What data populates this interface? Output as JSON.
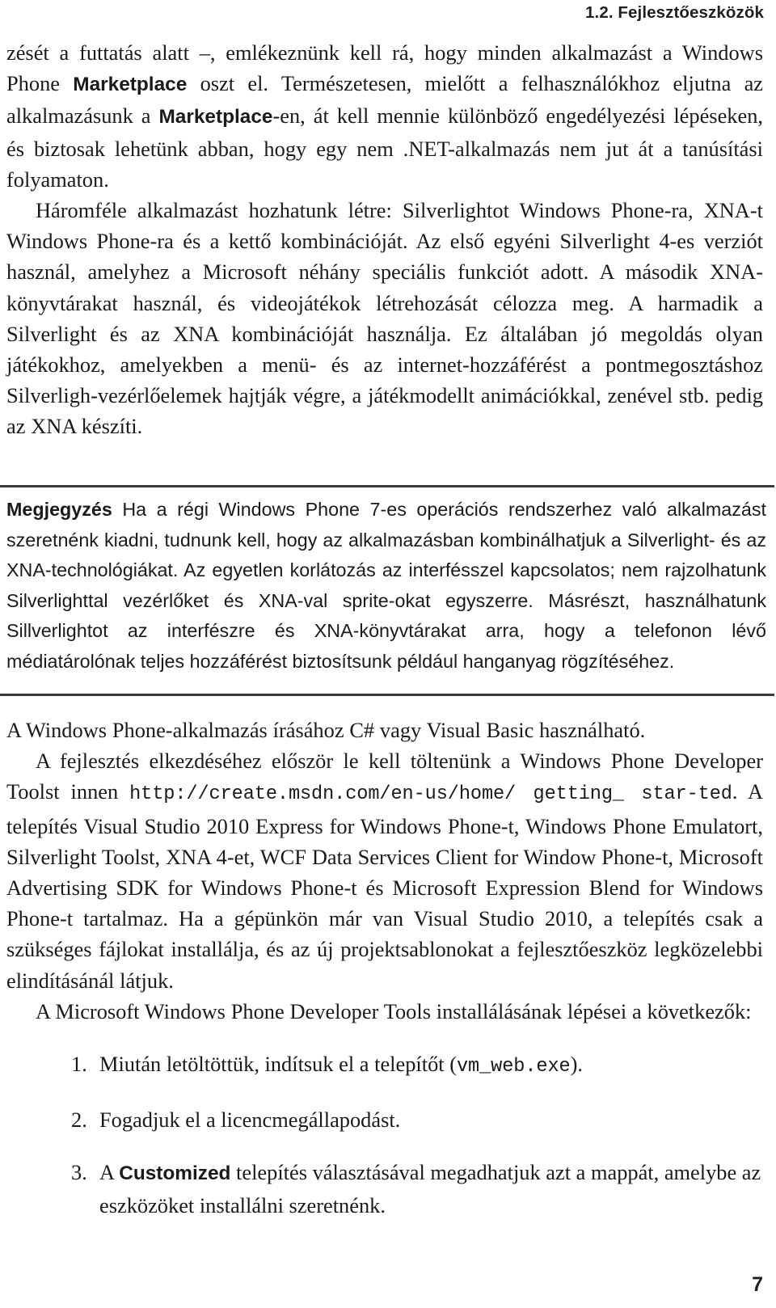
{
  "header": {
    "section_number_title": "1.2. Fejlesztőeszközök"
  },
  "body": {
    "para1_part1": "zését a futtatás alatt –, emlékeznünk kell rá, hogy minden alkalmazást a Windows Phone ",
    "para1_bold1": "Marketplace",
    "para1_part2": " oszt el. Természetesen, mielőtt a felhasználókhoz eljutna az alkalmazásunk a ",
    "para1_bold2": "Marketplace",
    "para1_part3": "-en, át kell mennie különböző engedélyezési lépéseken, és biztosak lehetünk abban, hogy egy nem .NET-alkalmazás nem jut át a tanúsítási folyamaton.",
    "para2": "Háromféle alkalmazást hozhatunk létre: Silverlightot Windows Phone-ra, XNA-t Windows Phone-ra és a kettő kombinációját. Az első egyéni Silverlight 4-es verziót használ, amelyhez a Microsoft néhány speciális funkciót adott. A második XNA-könyvtárakat használ, és videojátékok létrehozását célozza meg. A harmadik a Silverlight és az XNA kombinációját használja. Ez általában jó megoldás olyan játékokhoz, amelyekben a menü- és az internet-hozzáférést a pontmegosztáshoz Silverligh-vezérlőelemek hajtják végre, a játékmodellt animációkkal, zenével stb. pedig az XNA készíti."
  },
  "note": {
    "label": "Megjegyzés",
    "text": " Ha a régi Windows Phone 7-es operációs rendszerhez való alkalmazást szeretnénk kiadni, tudnunk kell, hogy az alkalmazásban kombinálhatjuk a Silverlight- és az XNA-technológiákat. Az egyetlen korlátozás az interfésszel kapcsolatos; nem rajzolhatunk Silverlighttal vezérlőket és XNA-val sprite-okat egyszerre. Másrészt, használhatunk Sillverlightot az interfészre és XNA-könyvtárakat arra, hogy a telefonon lévő médiatárolónak teljes hozzáférést biztosítsunk például hanganyag rögzítéséhez."
  },
  "lower": {
    "para3": "A Windows Phone-alkalmazás írásához C# vagy Visual Basic használható.",
    "para4_part1": "A fejlesztés elkezdéséhez először le kell töltenünk a Windows Phone Developer Toolst innen ",
    "para4_url": "http://create.msdn.com/en-us/home/ getting_ star-ted",
    "para4_part2": ". A telepítés Visual Studio 2010 Express for Windows Phone-t, Windows Phone Emulatort, Silverlight Toolst, XNA 4-et, WCF Data Services Client for Window Phone-t, Microsoft Advertising SDK for Windows Phone-t és Microsoft Expression Blend for Windows Phone-t tartalmaz. Ha a gépünkön már van Visual Studio 2010, a telepítés csak a szükséges fájlokat installálja, és az új projektsablonokat a fejlesztőeszköz legközelebbi elindításánál látjuk.",
    "para5": "A Microsoft Windows Phone Developer Tools installálásának lépései a következők:"
  },
  "steps": [
    {
      "marker": "1.",
      "text_part1": "Miután letöltöttük, indítsuk el a telepítőt (",
      "code": "vm_web.exe",
      "text_part2": ")."
    },
    {
      "marker": "2.",
      "text_part1": "Fogadjuk el a licencmegállapodást.",
      "code": "",
      "text_part2": ""
    },
    {
      "marker": "3.",
      "text_part1": "A ",
      "bold": "Customized",
      "text_part2": " telepítés választásával megadhatjuk azt a mappát, amelybe az eszközöket installálni szeretnénk."
    }
  ],
  "folio": {
    "page_number": "7"
  }
}
